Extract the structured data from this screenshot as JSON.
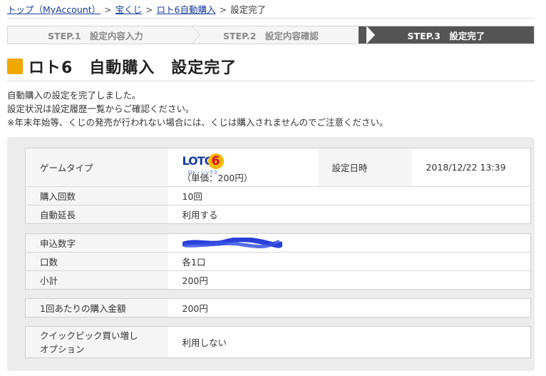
{
  "breadcrumb": {
    "top": "トップ（MyAccount）",
    "takarakuji": "宝くじ",
    "loto6": "ロト6自動購入",
    "current": "設定完了",
    "sep": ">"
  },
  "steps": [
    {
      "label": "STEP.1　設定内容入力"
    },
    {
      "label": "STEP.2　設定内容確認"
    },
    {
      "label": "STEP.3　設定完了"
    }
  ],
  "title": "ロト6　自動購入　設定完了",
  "messages": [
    "自動購入の設定を完了しました。",
    "設定状況は設定履歴一覧からご確認ください。",
    "※年末年始等、くじの発売が行われない場合には、くじは購入されませんのでご注意ください。"
  ],
  "logo": {
    "loto": "LOTO",
    "six": "6",
    "sub": "ロト・シックス"
  },
  "table1": {
    "game_type_label": "ゲームタイプ",
    "game_type_price": "（単価：200円）",
    "date_label": "設定日時",
    "date_value": "2018/12/22 13:39",
    "count_label": "購入回数",
    "count_value": "10回",
    "extend_label": "自動延長",
    "extend_value": "利用する"
  },
  "table2": {
    "numbers_label": "申込数字",
    "units_label": "口数",
    "units_value": "各1口",
    "subtotal_label": "小計",
    "subtotal_value": "200円"
  },
  "table3": {
    "per_label": "1回あたりの購入金額",
    "per_value": "200円"
  },
  "table4": {
    "quickpick_label_1": "クイックピック買い増し",
    "quickpick_label_2": "オプション",
    "quickpick_value": "利用しない"
  },
  "colors": {
    "accent": "#f0a800",
    "step_active": "#555555",
    "link": "#1a3c9c",
    "redaction": "#2a3fd8"
  }
}
